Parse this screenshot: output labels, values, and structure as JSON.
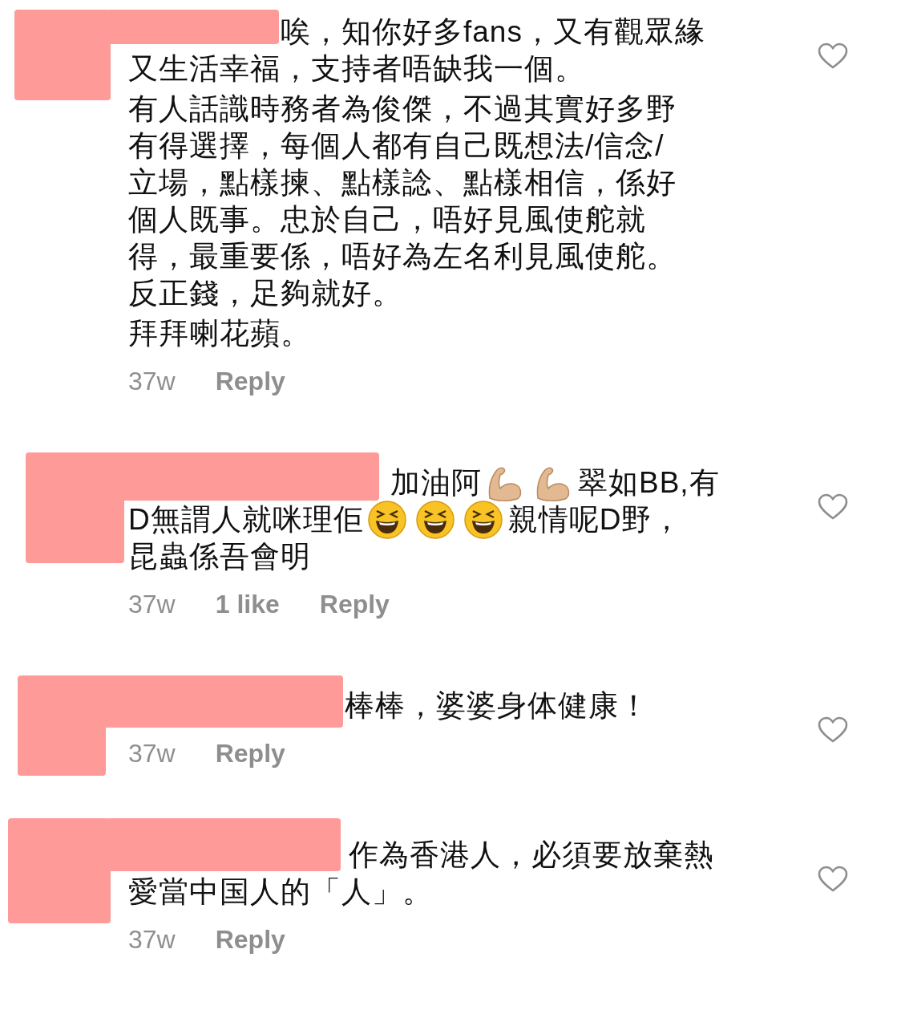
{
  "comments": [
    {
      "redacted": true,
      "paragraphs": [
        [
          "唉，知你好多fans，又有觀眾緣",
          "又生活幸福，支持者唔缺我一個。"
        ],
        [
          "有人話識時務者為俊傑，不過其實好多野",
          "有得選擇，每個人都有自己既想法/信念/",
          "立場，點樣揀、點樣諗、點樣相信，係好",
          "個人既事。忠於自己，唔好見風使舵就",
          "得，最重要係，唔好為左名利見風使舵。",
          "反正錢，足夠就好。"
        ],
        [
          "拜拜喇花蘋。"
        ]
      ],
      "liked": false,
      "meta": [
        {
          "kind": "time",
          "text": "37w"
        },
        {
          "kind": "reply",
          "text": "Reply"
        }
      ]
    },
    {
      "redacted": true,
      "paragraphs": [
        [
          [
            {
              "kind": "text",
              "text": "加油阿"
            },
            {
              "kind": "muscle"
            },
            {
              "kind": "muscle"
            },
            {
              "kind": "text",
              "text": "翠如BB,有"
            }
          ],
          [
            {
              "kind": "text",
              "text": "D無謂人就咪理佢"
            },
            {
              "kind": "laugh"
            },
            {
              "kind": "laugh"
            },
            {
              "kind": "laugh"
            },
            {
              "kind": "text",
              "text": "親情呢D野，"
            }
          ],
          "昆蟲係吾會明"
        ]
      ],
      "liked": false,
      "meta": [
        {
          "kind": "time",
          "text": "37w"
        },
        {
          "kind": "likes",
          "text": "1 like"
        },
        {
          "kind": "reply",
          "text": "Reply"
        }
      ]
    },
    {
      "redacted": true,
      "paragraphs": [
        [
          "棒棒，婆婆身体健康！"
        ]
      ],
      "liked": false,
      "meta": [
        {
          "kind": "time",
          "text": "37w"
        },
        {
          "kind": "reply",
          "text": "Reply"
        }
      ]
    },
    {
      "redacted": true,
      "paragraphs": [
        [
          "作為香港人，必須要放棄熱",
          "愛當中国人的「人」。"
        ]
      ],
      "liked": false,
      "meta": [
        {
          "kind": "time",
          "text": "37w"
        },
        {
          "kind": "reply",
          "text": "Reply"
        }
      ]
    }
  ]
}
